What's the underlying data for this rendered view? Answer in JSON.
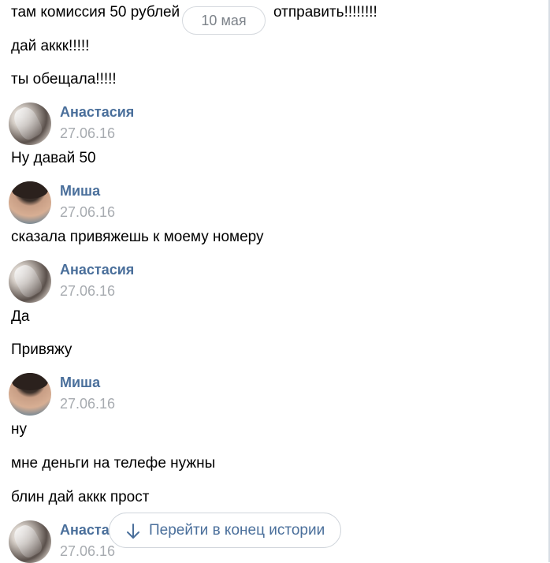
{
  "date_separator": "10 мая",
  "colors": {
    "author_name": "#4a6f9b",
    "date_text": "#a7abb0",
    "link": "#4a6f9b"
  },
  "messages_top": [
    {
      "text": "там комиссия 50 рублей",
      "text_right": "отправить!!!!!!!!"
    },
    {
      "text": "дай аккк!!!!!"
    },
    {
      "text": "ты обещала!!!!!"
    }
  ],
  "groups": [
    {
      "author": "Анастасия",
      "date": "27.06.16",
      "avatar": "anastasia-avatar",
      "messages": [
        "Ну давай 50"
      ]
    },
    {
      "author": "Миша",
      "date": "27.06.16",
      "avatar": "misha-avatar",
      "messages": [
        "сказала привяжешь к моему номеру"
      ]
    },
    {
      "author": "Анастасия",
      "date": "27.06.16",
      "avatar": "anastasia-avatar",
      "messages": [
        "Да",
        "Привяжу"
      ]
    },
    {
      "author": "Миша",
      "date": "27.06.16",
      "avatar": "misha-avatar",
      "messages": [
        "ну",
        "мне деньги на телефе нужны",
        "блин дай аккк прост"
      ]
    },
    {
      "author": "Анаста",
      "date": "27.06.16",
      "avatar": "anastasia-avatar",
      "messages": []
    }
  ],
  "jump_button": {
    "label": "Перейти в конец истории",
    "icon": "arrow-down-icon"
  }
}
